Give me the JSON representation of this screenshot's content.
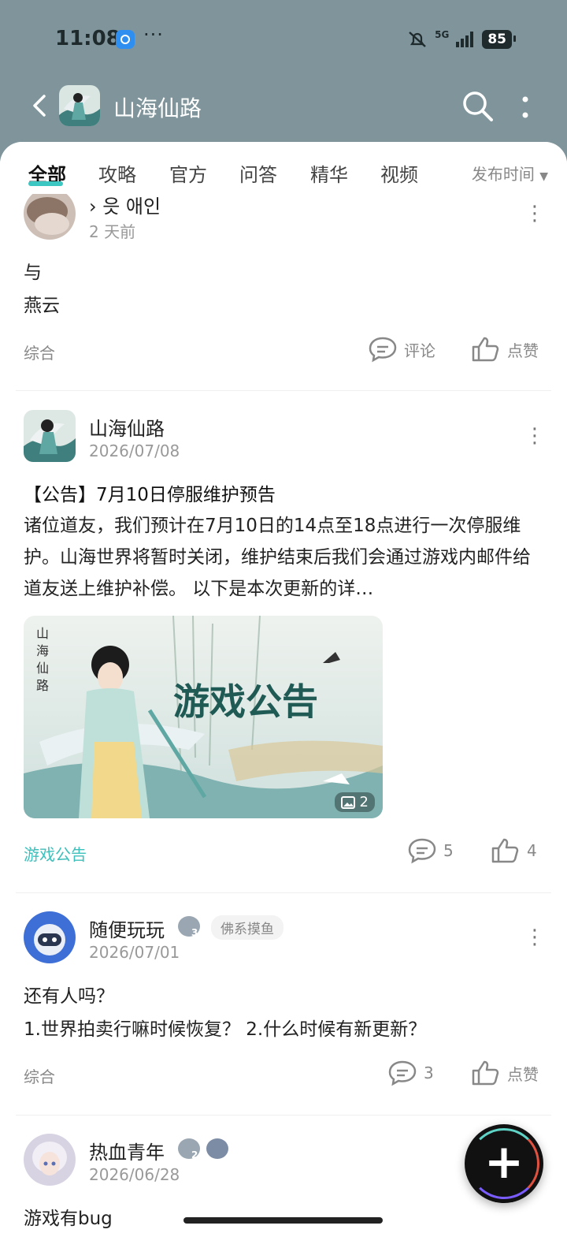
{
  "status": {
    "time": "11:08",
    "dots": "···",
    "network": "5G",
    "battery": "85"
  },
  "header": {
    "title": "山海仙路"
  },
  "tabs": {
    "items": [
      "全部",
      "攻略",
      "官方",
      "问答",
      "精华",
      "视频"
    ],
    "sort": "发布时间"
  },
  "posts": [
    {
      "author": "› 읏 애인",
      "date": "2 天前",
      "lines": [
        "与",
        "燕云"
      ],
      "tag": "综合",
      "comment": "评论",
      "like": "点赞"
    },
    {
      "author": "山海仙路",
      "date": "2026/07/08",
      "title": "【公告】7月10日停服维护预告",
      "body": "诸位道友，我们预计在7月10日的14点至18点进行一次停服维护。山海世界将暂时关闭，维护结束后我们会通过游戏内邮件给道友送上维护补偿。 以下是本次更新的详…",
      "banner_logo": "山海仙路",
      "banner_text": "游戏公告",
      "image_count": "2",
      "tag": "游戏公告",
      "comment": "5",
      "like": "4"
    },
    {
      "author": "随便玩玩",
      "level": "3",
      "badge": "佛系摸鱼",
      "date": "2026/07/01",
      "lines": [
        "还有人吗？",
        "1.世界拍卖行嘛时候恢复？ 2.什么时候有新更新？"
      ],
      "tag": "综合",
      "comment": "3",
      "like": "点赞"
    },
    {
      "author": "热血青年",
      "level": "2",
      "date": "2026/06/28",
      "lines": [
        "游戏有bug"
      ]
    }
  ],
  "colors": {
    "header_bg": "#7f959b",
    "accent": "#3dc7c2",
    "link": "#3dbfbb"
  },
  "icons": [
    "back-icon",
    "search-icon",
    "more-icon",
    "comment-icon",
    "like-icon",
    "image-icon",
    "plus-icon"
  ]
}
